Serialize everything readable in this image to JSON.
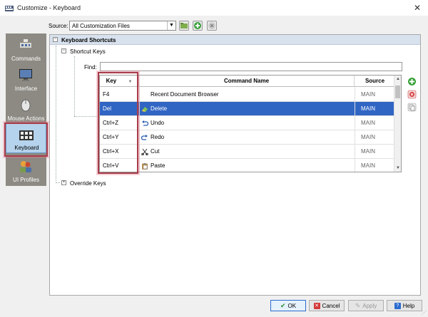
{
  "window": {
    "title": "Customize - Keyboard"
  },
  "toolbar": {
    "source_label": "Source:",
    "source_value": "All Customization Files"
  },
  "sidebar": {
    "items": [
      {
        "label": "Commands"
      },
      {
        "label": "Interface"
      },
      {
        "label": "Mouse Actions"
      },
      {
        "label": "Keyboard"
      },
      {
        "label": "UI Profiles"
      }
    ],
    "active": "Keyboard"
  },
  "main": {
    "section_title": "Keyboard Shortcuts",
    "shortcut_keys_label": "Shortcut Keys",
    "find_label": "Find:",
    "find_value": "",
    "override_keys_label": "Override Keys",
    "columns": {
      "key": "Key",
      "command": "Command Name",
      "source": "Source"
    },
    "rows": [
      {
        "key": "F4",
        "command": "Recent Document Browser",
        "source": "MAIN",
        "icon": "none"
      },
      {
        "key": "Del",
        "command": "Delete",
        "source": "MAIN",
        "icon": "eraser-icon"
      },
      {
        "key": "Ctrl+Z",
        "command": "Undo",
        "source": "MAIN",
        "icon": "undo-icon"
      },
      {
        "key": "Ctrl+Y",
        "command": "Redo",
        "source": "MAIN",
        "icon": "redo-icon"
      },
      {
        "key": "Ctrl+X",
        "command": "Cut",
        "source": "MAIN",
        "icon": "scissors-icon"
      },
      {
        "key": "Ctrl+V",
        "command": "Paste",
        "source": "MAIN",
        "icon": "clipboard-icon"
      }
    ],
    "selected_row": 1
  },
  "buttons": {
    "ok": "OK",
    "cancel": "Cancel",
    "apply": "Apply",
    "help": "Help"
  },
  "colors": {
    "selection": "#3165c4",
    "highlight": "#a83c4a",
    "sidebar": "#8c8a82",
    "section_header": "#d8e2ee"
  }
}
